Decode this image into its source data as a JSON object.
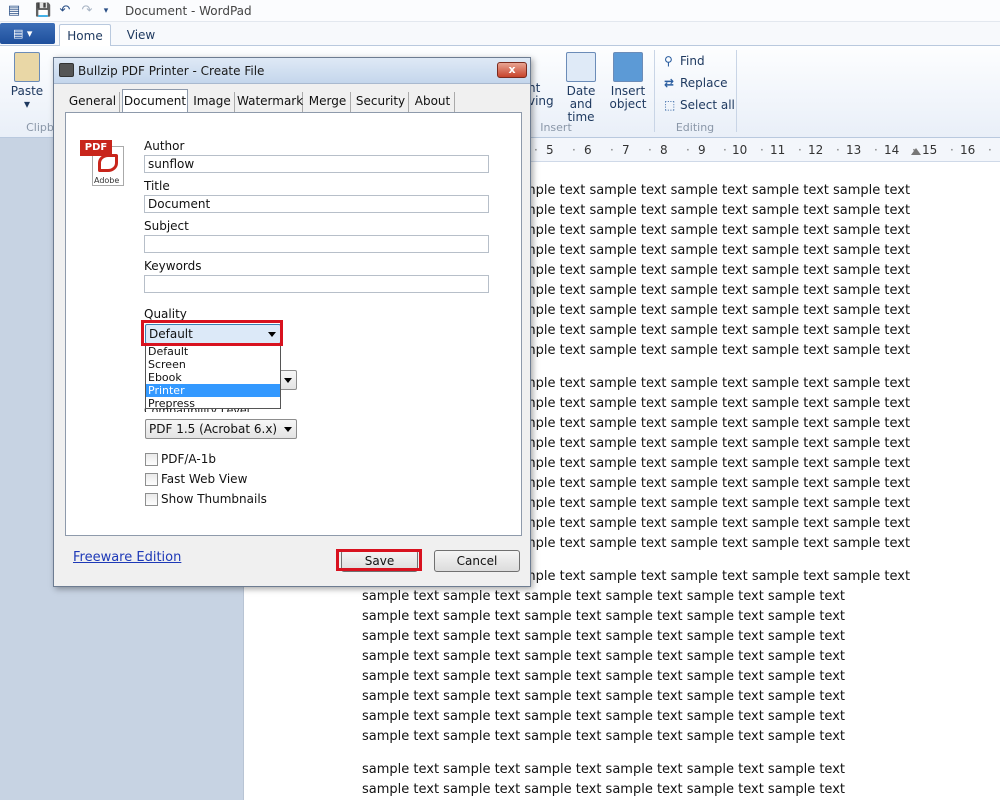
{
  "wordpad": {
    "window_title": "Document - WordPad",
    "tabs": [
      "Home",
      "View"
    ],
    "ribbon": {
      "paste_label": "Paste",
      "clipboard_group": "Clipb",
      "insert_group": "Insert",
      "editing_group": "Editing",
      "partial_button_line1": "nt",
      "partial_button_line2": "ving",
      "date_time_line1": "Date and",
      "date_time_line2": "time",
      "insert_object_line1": "Insert",
      "insert_object_line2": "object",
      "find_label": "Find",
      "replace_label": "Replace",
      "select_all_label": "Select all"
    },
    "ruler_marks": [
      "5",
      "6",
      "7",
      "8",
      "9",
      "10",
      "11",
      "12",
      "13",
      "14",
      "15",
      "16"
    ],
    "doc_line_partial": "mple text sample text sample text sample text sample text",
    "doc_line_full": "sample text sample text sample text sample text sample text sample text"
  },
  "dialog": {
    "title": "Bullzip PDF Printer - Create File",
    "close_label": "x",
    "tabs": [
      "General",
      "Document",
      "Image",
      "Watermark",
      "Merge",
      "Security",
      "About"
    ],
    "active_tab": "Document",
    "pdf_badge": "PDF",
    "adobe_label": "Adobe",
    "fields": {
      "author": {
        "label": "Author",
        "value": "sunflow"
      },
      "title": {
        "label": "Title",
        "value": "Document"
      },
      "subject": {
        "label": "Subject",
        "value": ""
      },
      "keywords": {
        "label": "Keywords",
        "value": ""
      }
    },
    "quality": {
      "label": "Quality",
      "selected": "Default",
      "options": [
        "Default",
        "Screen",
        "Ebook",
        "Printer",
        "Prepress"
      ],
      "highlighted_option": "Printer"
    },
    "compatibility": {
      "label": "Compatibility Level",
      "selected": "PDF 1.5 (Acrobat 6.x)"
    },
    "checkboxes": [
      {
        "label": "PDF/A-1b",
        "checked": false
      },
      {
        "label": "Fast Web View",
        "checked": false
      },
      {
        "label": "Show Thumbnails",
        "checked": false
      }
    ],
    "freeware_link": "Freeware Edition",
    "save_label": "Save",
    "cancel_label": "Cancel"
  }
}
